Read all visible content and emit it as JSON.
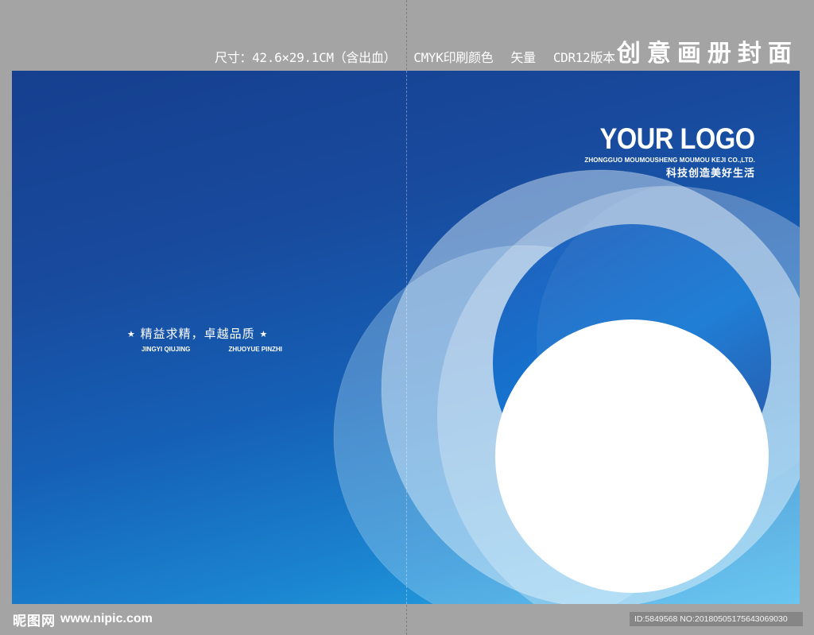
{
  "header": {
    "size_spec": "尺寸：42.6×29.1CM（含出血）",
    "color_spec": "CMYK印刷颜色",
    "vector_spec": "矢量",
    "version_spec": "CDR12版本",
    "title": "创意画册封面"
  },
  "cover": {
    "logo": {
      "main": "YOUR LOGO",
      "company": "ZHONGGUO MOUMOUSHENG MOUMOU KEJI CO.,LTD.",
      "slogan": "科技创造美好生活"
    },
    "motto": {
      "star_left": "★",
      "chinese": "精益求精，卓越品质",
      "star_right": "★",
      "pinyin_left": "JINGYI QIUJING",
      "pinyin_right": "ZHUOYUE PINZHI"
    }
  },
  "watermark": {
    "brand": "昵图网",
    "url": "www.nipic.com",
    "id_text": "ID:5849568 NO:20180505175643069030"
  },
  "colors": {
    "background": "#a4a4a4",
    "cover_dark_blue": "#163f8f",
    "cover_light_blue": "#2fb1ea",
    "white": "#ffffff"
  }
}
